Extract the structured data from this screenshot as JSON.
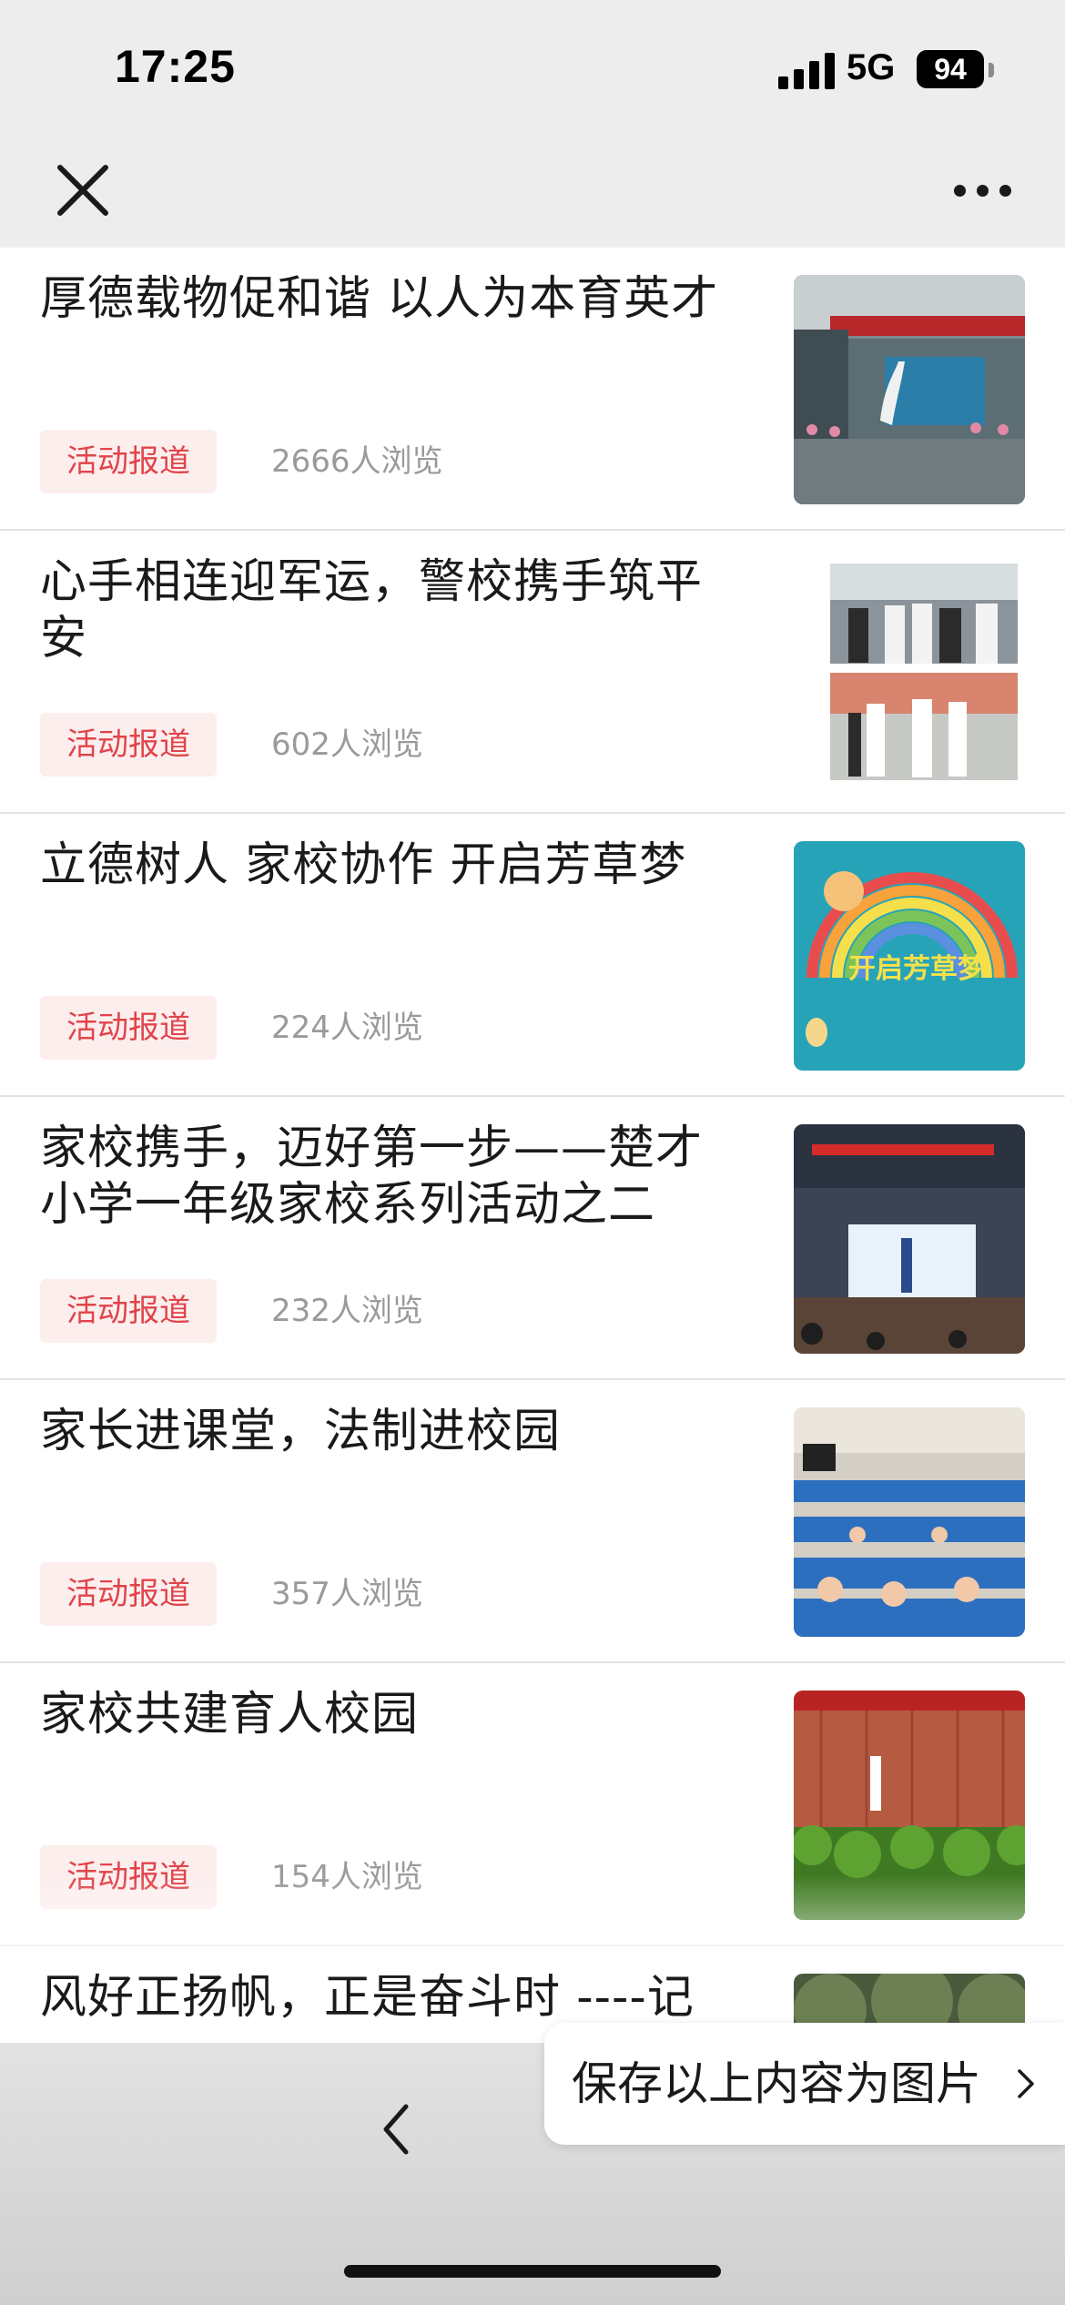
{
  "status_bar": {
    "time": "17:25",
    "network": "5G",
    "battery": "94"
  },
  "nav": {
    "close_icon": "close-icon",
    "more_icon": "more-dots-icon"
  },
  "articles": [
    {
      "title": "厚德载物促和谐 以人为本育英才",
      "tag": "活动报道",
      "views": "2666人浏览",
      "thumb": "school-entrance-photo"
    },
    {
      "title": "心手相连迎军运，警校携手筑平安",
      "tag": "活动报道",
      "views": "602人浏览",
      "thumb": "police-visit-photo"
    },
    {
      "title": "立德树人 家校协作 开启芳草梦",
      "tag": "活动报道",
      "views": "224人浏览",
      "thumb": "rainbow-poster",
      "thumb_caption": "开启芳草梦"
    },
    {
      "title": "家校携手，迈好第一步——楚才小学一年级家校系列活动之二",
      "tag": "活动报道",
      "views": "232人浏览",
      "thumb": "auditorium-stage-photo"
    },
    {
      "title": "家长进课堂，法制进校园",
      "tag": "活动报道",
      "views": "357人浏览",
      "thumb": "classroom-students-photo"
    },
    {
      "title": "家校共建育人校园",
      "tag": "活动报道",
      "views": "154人浏览",
      "thumb": "outdoor-event-photo"
    },
    {
      "title": "风好正扬帆，正是奋斗时 ----记",
      "tag": "",
      "views": "",
      "thumb": "trees-photo"
    }
  ],
  "toolbar": {
    "back_icon": "chevron-left-icon"
  },
  "save_popup": {
    "label": "保存以上内容为图片",
    "icon": "chevron-right-icon"
  },
  "colors": {
    "tag_text": "#e0444a",
    "tag_bg": "#fdeeee",
    "views_text": "#9a9a9a",
    "bar_bg": "#ededed"
  }
}
